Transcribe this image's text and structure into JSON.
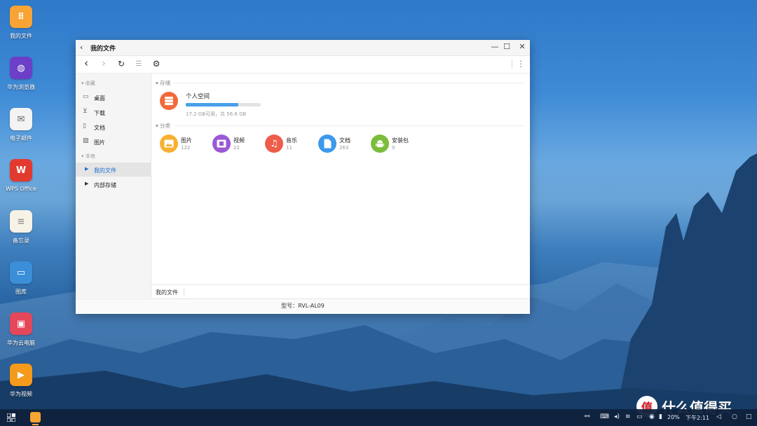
{
  "desktop_icons": [
    {
      "label": "我的文件",
      "icon": "files-icon",
      "color": "#f7a434",
      "glyph": "⠿"
    },
    {
      "label": "华为浏览器",
      "icon": "browser-icon",
      "color": "#6b3fc8",
      "glyph": "◍"
    },
    {
      "label": "电子邮件",
      "icon": "email-icon",
      "color": "#f3f3f3",
      "glyph": "✉"
    },
    {
      "label": "WPS Office",
      "icon": "wps-icon",
      "color": "#e33a2f",
      "glyph": "W"
    },
    {
      "label": "备忘录",
      "icon": "notes-icon",
      "color": "#f7f2e6",
      "glyph": "≡"
    },
    {
      "label": "图库",
      "icon": "gallery-icon",
      "color": "#3b8fd8",
      "glyph": "▭"
    },
    {
      "label": "华为云电脑",
      "icon": "cloud-pc-icon",
      "color": "#e5475a",
      "glyph": "▣"
    },
    {
      "label": "华为视频",
      "icon": "video-icon",
      "color": "#f59a1b",
      "glyph": "▶"
    }
  ],
  "window": {
    "title": "我的文件",
    "back_glyph": "‹",
    "controls": {
      "minimize": "—",
      "maximize": "☐",
      "close": "✕"
    },
    "toolbar": {
      "back": "‹",
      "forward": "›",
      "refresh": "↻",
      "list": "☰",
      "settings": "⚙",
      "more": "⋮"
    },
    "sidebar": {
      "favorites_header": "收藏",
      "favorites": [
        {
          "label": "桌面",
          "icon": "desktop-icon",
          "glyph": "▭"
        },
        {
          "label": "下载",
          "icon": "download-icon",
          "glyph": "⊻"
        },
        {
          "label": "文档",
          "icon": "document-icon",
          "glyph": "▯"
        },
        {
          "label": "图片",
          "icon": "picture-icon",
          "glyph": "▨"
        }
      ],
      "local_header": "本地",
      "local": [
        {
          "label": "我的文件",
          "active": true
        },
        {
          "label": "内部存储",
          "active": false
        }
      ]
    },
    "storage": {
      "header": "存储",
      "name": "个人空间",
      "usage_fraction": 0.7,
      "detail": "17.2 GB可用，共 56.6 GB"
    },
    "categories": {
      "header": "分类",
      "items": [
        {
          "name": "图片",
          "count": "122",
          "color": "#f8b033",
          "icon": "image-category-icon",
          "glyph": "▲"
        },
        {
          "name": "视频",
          "count": "22",
          "color": "#9b59d6",
          "icon": "video-category-icon",
          "glyph": "▦"
        },
        {
          "name": "音乐",
          "count": "11",
          "color": "#ef5d4a",
          "icon": "music-category-icon",
          "glyph": "♫"
        },
        {
          "name": "文档",
          "count": "263",
          "color": "#3c99ec",
          "icon": "document-category-icon",
          "glyph": "▤"
        },
        {
          "name": "安装包",
          "count": "0",
          "color": "#7cbd3c",
          "icon": "android-category-icon",
          "glyph": "⚙"
        }
      ]
    },
    "breadcrumb": "我的文件",
    "status": "型号：RVL-AL09"
  },
  "taskbar": {
    "battery": "20%",
    "time": "下午2:11"
  },
  "watermark": {
    "text": "什么值得买",
    "badge": "值"
  }
}
